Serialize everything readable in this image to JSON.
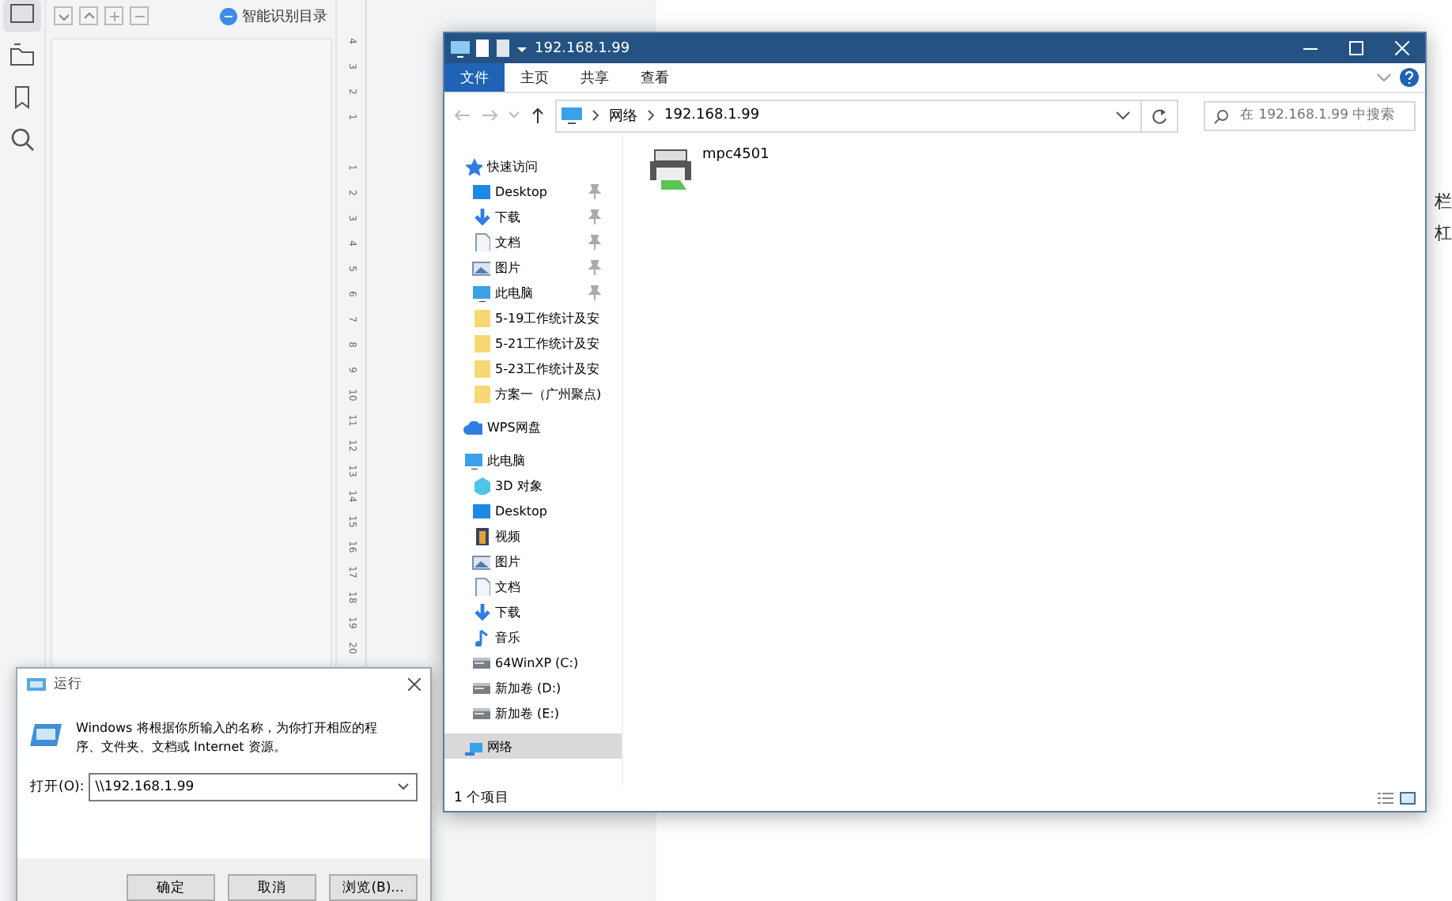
{
  "wps": {
    "sidebar_icons": [
      {
        "kind": "panel",
        "selected": true
      },
      {
        "kind": "folder",
        "selected": false
      },
      {
        "kind": "bookmark",
        "selected": false
      },
      {
        "kind": "search",
        "selected": false
      }
    ],
    "toc_tools": [
      {
        "kind": "expand"
      },
      {
        "kind": "collapse"
      },
      {
        "kind": "add"
      },
      {
        "kind": "remove"
      }
    ],
    "toc_button": "智能识别目录",
    "ruler_marks": [
      "4",
      "3",
      "2",
      "1",
      "1",
      "2",
      "3",
      "4",
      "5",
      "6",
      "7",
      "8",
      "9",
      "10",
      "11",
      "12",
      "13",
      "14",
      "15",
      "16",
      "17",
      "18",
      "19",
      "20"
    ],
    "doc_lines": [
      "栏",
      "杠"
    ]
  },
  "explorer": {
    "title": "192.168.1.99",
    "tabs": [
      {
        "label": "文件",
        "selected": true
      },
      {
        "label": "主页",
        "selected": false
      },
      {
        "label": "共享",
        "selected": false
      },
      {
        "label": "查看",
        "selected": false
      }
    ],
    "path": [
      "网络",
      "192.168.1.99"
    ],
    "search": {
      "placeholder": "在 192.168.1.99 中搜索"
    },
    "nav": [
      {
        "label": "快速访问",
        "kind": "star",
        "selected": false,
        "children": [
          {
            "label": "Desktop",
            "kind": "desktop",
            "pinned": true,
            "selected": false
          },
          {
            "label": "下载",
            "kind": "download",
            "pinned": true,
            "selected": false
          },
          {
            "label": "文档",
            "kind": "doc",
            "pinned": true,
            "selected": false
          },
          {
            "label": "图片",
            "kind": "picture",
            "pinned": true,
            "selected": false
          },
          {
            "label": "此电脑",
            "kind": "pc",
            "pinned": true,
            "selected": false
          },
          {
            "label": "5-19工作统计及安",
            "kind": "folder",
            "pinned": false,
            "selected": false
          },
          {
            "label": "5-21工作统计及安",
            "kind": "folder",
            "pinned": false,
            "selected": false
          },
          {
            "label": "5-23工作统计及安",
            "kind": "folder",
            "pinned": false,
            "selected": false
          },
          {
            "label": "方案一（广州聚点)",
            "kind": "folder",
            "pinned": false,
            "selected": false
          }
        ]
      },
      {
        "label": "WPS网盘",
        "kind": "cloud",
        "selected": false
      },
      {
        "label": "此电脑",
        "kind": "pc",
        "selected": false,
        "children": [
          {
            "label": "3D 对象",
            "kind": "cube",
            "pinned": false,
            "selected": false
          },
          {
            "label": "Desktop",
            "kind": "desktop",
            "pinned": false,
            "selected": false
          },
          {
            "label": "视频",
            "kind": "video",
            "pinned": false,
            "selected": false
          },
          {
            "label": "图片",
            "kind": "picture",
            "pinned": false,
            "selected": false
          },
          {
            "label": "文档",
            "kind": "doc",
            "pinned": false,
            "selected": false
          },
          {
            "label": "下载",
            "kind": "download",
            "pinned": false,
            "selected": false
          },
          {
            "label": "音乐",
            "kind": "music",
            "pinned": false,
            "selected": false
          },
          {
            "label": "64WinXP  (C:)",
            "kind": "drive",
            "pinned": false,
            "selected": false
          },
          {
            "label": "新加卷 (D:)",
            "kind": "drive",
            "pinned": false,
            "selected": false
          },
          {
            "label": "新加卷 (E:)",
            "kind": "drive",
            "pinned": false,
            "selected": false
          }
        ]
      },
      {
        "label": "网络",
        "kind": "network",
        "selected": true
      }
    ],
    "files": [
      {
        "name": "mpc4501",
        "kind": "printer"
      }
    ],
    "status": "1 个项目"
  },
  "run": {
    "title": "运行",
    "message": "Windows 将根据你所输入的名称，为你打开相应的程序、文件夹、文档或 Internet 资源。",
    "open_label": "打开(O):",
    "value": "\\\\192.168.1.99",
    "buttons": [
      "确定",
      "取消",
      "浏览(B)..."
    ]
  }
}
